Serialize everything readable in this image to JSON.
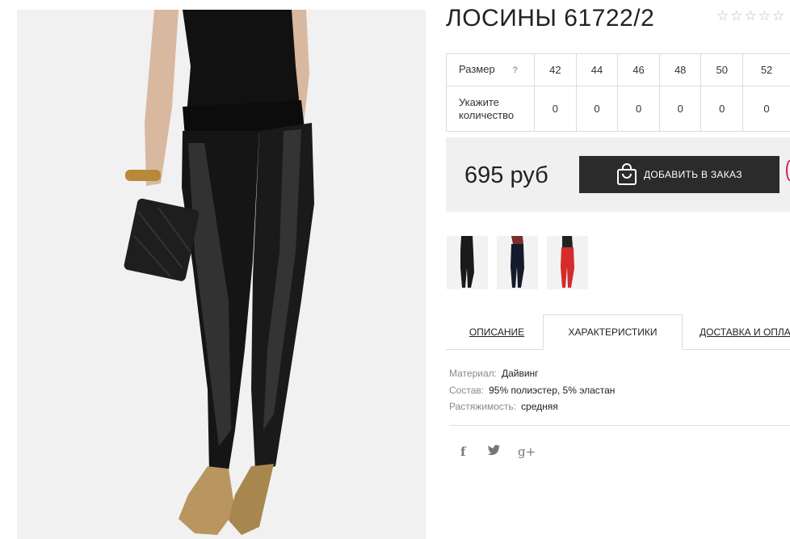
{
  "product": {
    "title": "ЛОСИНЫ 61722/2",
    "rating_stars": "☆☆☆☆☆"
  },
  "size_table": {
    "size_label": "Размер",
    "help": "?",
    "sizes": [
      "42",
      "44",
      "46",
      "48",
      "50",
      "52"
    ],
    "quantity_label_line1": "Укажите",
    "quantity_label_line2": "количество",
    "quantities": [
      "0",
      "0",
      "0",
      "0",
      "0",
      "0"
    ]
  },
  "purchase": {
    "price": "695 руб",
    "order_button": "ДОБАВИТЬ В ЗАКАЗ"
  },
  "tabs": {
    "description": "ОПИСАНИЕ",
    "characteristics": "ХАРАКТЕРИСТИКИ",
    "delivery": "ДОСТАВКА И ОПЛАТА"
  },
  "specs": [
    {
      "key": "Материал:",
      "value": "Дайвинг"
    },
    {
      "key": "Состав:",
      "value": "95% полиэстер, 5% эластан"
    },
    {
      "key": "Растяжимость:",
      "value": "средняя"
    }
  ],
  "social": {
    "facebook": "f",
    "twitter": "🐦",
    "google_plus": "g+"
  },
  "colors": {
    "button_bg": "#2b2b2b",
    "panel_bg": "#f0f0f0",
    "thumb_red": "#d42b2b"
  }
}
